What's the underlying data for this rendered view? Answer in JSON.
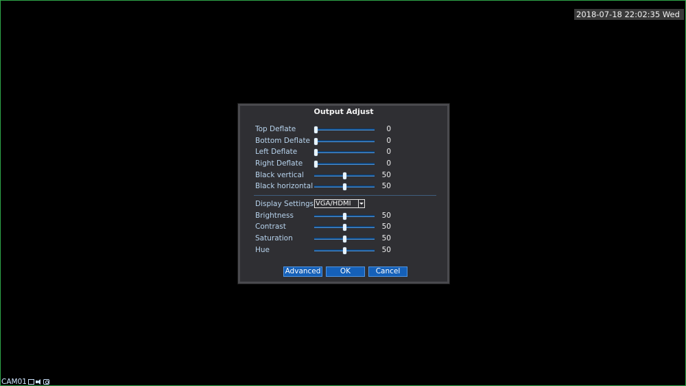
{
  "overlay": {
    "datetime": "2018-07-18 22:02:35 Wed",
    "camera_label": "CAM01"
  },
  "dialog": {
    "title": "Output Adjust",
    "rows": [
      {
        "label": "Top Deflate",
        "value": "0"
      },
      {
        "label": "Bottom Deflate",
        "value": "0"
      },
      {
        "label": "Left Deflate",
        "value": "0"
      },
      {
        "label": "Right Deflate",
        "value": "0"
      },
      {
        "label": "Black vertical",
        "value": "50"
      },
      {
        "label": "Black horizontal",
        "value": "50"
      }
    ],
    "display_settings": {
      "label": "Display Settings",
      "selected": "VGA/HDMI"
    },
    "picture_rows": [
      {
        "label": "Brightness",
        "value": "50"
      },
      {
        "label": "Contrast",
        "value": "50"
      },
      {
        "label": "Saturation",
        "value": "50"
      },
      {
        "label": "Hue",
        "value": "50"
      }
    ],
    "buttons": {
      "advanced": "Advanced",
      "ok": "OK",
      "cancel": "Cancel"
    }
  },
  "colors": {
    "accent": "#1560b8",
    "label_text": "#b8d4ee",
    "border_green": "#2fa84a"
  }
}
